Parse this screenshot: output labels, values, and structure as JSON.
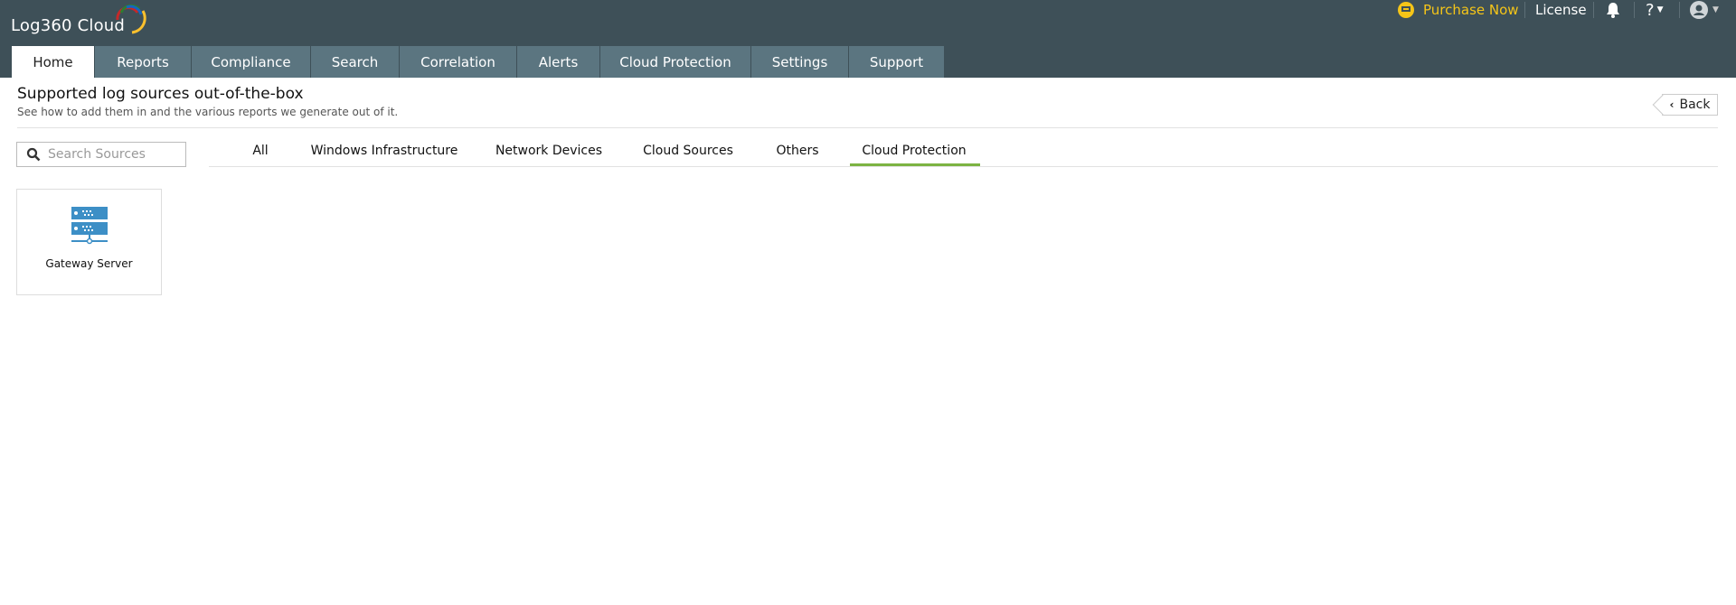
{
  "app": {
    "logo": "Log360 Cloud"
  },
  "topbar": {
    "purchase": "Purchase Now",
    "license": "License",
    "help": "?"
  },
  "nav": {
    "tabs": [
      {
        "label": "Home"
      },
      {
        "label": "Reports"
      },
      {
        "label": "Compliance"
      },
      {
        "label": "Search"
      },
      {
        "label": "Correlation"
      },
      {
        "label": "Alerts"
      },
      {
        "label": "Cloud Protection"
      },
      {
        "label": "Settings"
      },
      {
        "label": "Support"
      }
    ],
    "active": "Home"
  },
  "page": {
    "title": "Supported log sources out-of-the-box",
    "subtitle": "See how to add them in and the various reports we generate out of it.",
    "back": "Back"
  },
  "search": {
    "placeholder": "Search Sources",
    "value": ""
  },
  "filters": {
    "tabs": [
      {
        "label": "All"
      },
      {
        "label": "Windows Infrastructure"
      },
      {
        "label": "Network Devices"
      },
      {
        "label": "Cloud Sources"
      },
      {
        "label": "Others"
      },
      {
        "label": "Cloud Protection"
      }
    ],
    "active": "Cloud Protection"
  },
  "sources": [
    {
      "label": "Gateway Server",
      "icon": "server-icon"
    }
  ],
  "colors": {
    "header": "#3e5058",
    "tab": "#5b7580",
    "accent": "#7cb342",
    "purchase": "#f5c518",
    "icon": "#3d8fc6"
  }
}
